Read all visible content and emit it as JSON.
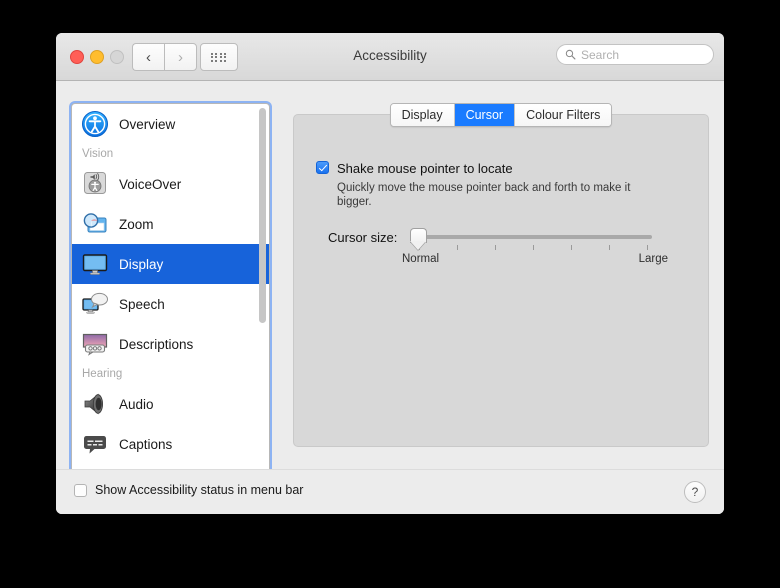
{
  "window": {
    "title": "Accessibility",
    "traffic_lights": [
      "close",
      "minimize",
      "zoom"
    ],
    "nav": {
      "back": "‹",
      "forward": "›"
    },
    "grid_button": "grid-icon"
  },
  "search": {
    "placeholder": "Search",
    "value": "",
    "icon": "search-icon"
  },
  "sidebar": {
    "items": [
      {
        "type": "item",
        "label": "Overview",
        "icon": "accessibility-icon",
        "selected": false
      },
      {
        "type": "group",
        "label": "Vision"
      },
      {
        "type": "item",
        "label": "VoiceOver",
        "icon": "voiceover-icon",
        "selected": false
      },
      {
        "type": "item",
        "label": "Zoom",
        "icon": "zoom-icon",
        "selected": false
      },
      {
        "type": "item",
        "label": "Display",
        "icon": "display-icon",
        "selected": true
      },
      {
        "type": "item",
        "label": "Speech",
        "icon": "speech-icon",
        "selected": false
      },
      {
        "type": "item",
        "label": "Descriptions",
        "icon": "descriptions-icon",
        "selected": false
      },
      {
        "type": "group",
        "label": "Hearing"
      },
      {
        "type": "item",
        "label": "Audio",
        "icon": "audio-icon",
        "selected": false
      },
      {
        "type": "item",
        "label": "Captions",
        "icon": "captions-icon",
        "selected": false
      }
    ]
  },
  "tabs": [
    {
      "label": "Display",
      "active": false
    },
    {
      "label": "Cursor",
      "active": true
    },
    {
      "label": "Colour Filters",
      "active": false
    }
  ],
  "panel": {
    "shake_checkbox": {
      "label": "Shake mouse pointer to locate",
      "description": "Quickly move the mouse pointer back and forth to make it bigger.",
      "checked": true
    },
    "cursor_size": {
      "label": "Cursor size:",
      "min_label": "Normal",
      "max_label": "Large",
      "value_percent": 0,
      "tick_count": 7
    }
  },
  "footer": {
    "menu_bar_checkbox": {
      "label": "Show Accessibility status in menu bar",
      "checked": false
    },
    "help_label": "?"
  },
  "colors": {
    "accent_blue": "#1a7bff",
    "selection_blue": "#1763da",
    "window_bg": "#ececec",
    "panel_bg": "#d8d8d8",
    "focus_ring": "#6ea0f5"
  }
}
